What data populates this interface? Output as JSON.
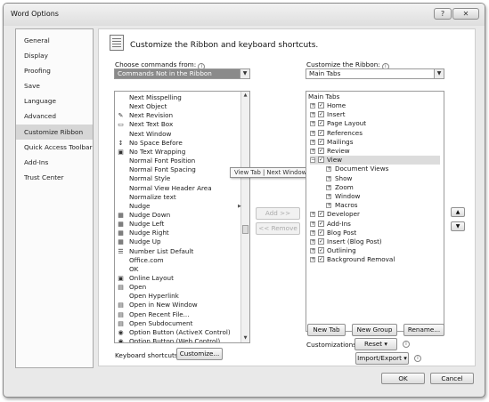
{
  "window": {
    "title": "Word Options",
    "help_label": "?",
    "close_label": "✕"
  },
  "sidebar": {
    "items": [
      {
        "label": "General"
      },
      {
        "label": "Display"
      },
      {
        "label": "Proofing"
      },
      {
        "label": "Save"
      },
      {
        "label": "Language"
      },
      {
        "label": "Advanced"
      },
      {
        "label": "Customize Ribbon",
        "active": true
      },
      {
        "label": "Quick Access Toolbar"
      },
      {
        "label": "Add-Ins"
      },
      {
        "label": "Trust Center"
      }
    ]
  },
  "main": {
    "title": "Customize the Ribbon and keyboard shortcuts.",
    "choose_label": "Choose commands from:",
    "choose_value": "Commands Not in the Ribbon",
    "customize_label": "Customize the Ribbon:",
    "customize_value": "Main Tabs",
    "info_icon": "i",
    "commands": [
      {
        "label": "Next Misspelling",
        "icon": ""
      },
      {
        "label": "Next Object",
        "icon": ""
      },
      {
        "label": "Next Revision",
        "icon": "✎"
      },
      {
        "label": "Next Text Box",
        "icon": "▭"
      },
      {
        "label": "Next Window",
        "icon": ""
      },
      {
        "label": "No Space Before",
        "icon": "↕"
      },
      {
        "label": "No Text Wrapping",
        "icon": "▣"
      },
      {
        "label": "Normal Font Position",
        "icon": ""
      },
      {
        "label": "Normal Font Spacing",
        "icon": ""
      },
      {
        "label": "Normal Style",
        "icon": ""
      },
      {
        "label": "Normal View Header Area",
        "icon": ""
      },
      {
        "label": "Normalize text",
        "icon": ""
      },
      {
        "label": "Nudge",
        "icon": "",
        "submenu": "▶"
      },
      {
        "label": "Nudge Down",
        "icon": "▦"
      },
      {
        "label": "Nudge Left",
        "icon": "▦"
      },
      {
        "label": "Nudge Right",
        "icon": "▦"
      },
      {
        "label": "Nudge Up",
        "icon": "▦"
      },
      {
        "label": "Number List Default",
        "icon": "☰"
      },
      {
        "label": "Office.com",
        "icon": ""
      },
      {
        "label": "OK",
        "icon": ""
      },
      {
        "label": "Online Layout",
        "icon": "▣"
      },
      {
        "label": "Open",
        "icon": "▤"
      },
      {
        "label": "Open Hyperlink",
        "icon": ""
      },
      {
        "label": "Open in New Window",
        "icon": "▤"
      },
      {
        "label": "Open Recent File...",
        "icon": "▤"
      },
      {
        "label": "Open Subdocument",
        "icon": "▤"
      },
      {
        "label": "Option Button (ActiveX Control)",
        "icon": "◉"
      },
      {
        "label": "Option Button (Web Control)",
        "icon": "◉"
      }
    ],
    "tooltip": "View Tab | Next Window | Next Window (WindowNext)",
    "add_button": "Add >>",
    "remove_button": "<< Remove",
    "tree_header": "Main Tabs",
    "tree": [
      {
        "label": "Home",
        "level": 0,
        "expander": "+",
        "checked": "✓"
      },
      {
        "label": "Insert",
        "level": 0,
        "expander": "+",
        "checked": "✓"
      },
      {
        "label": "Page Layout",
        "level": 0,
        "expander": "+",
        "checked": "✓"
      },
      {
        "label": "References",
        "level": 0,
        "expander": "+",
        "checked": "✓"
      },
      {
        "label": "Mailings",
        "level": 0,
        "expander": "+",
        "checked": "✓"
      },
      {
        "label": "Review",
        "level": 0,
        "expander": "+",
        "checked": "✓"
      },
      {
        "label": "View",
        "level": 0,
        "expander": "−",
        "checked": "✓",
        "selected": true
      },
      {
        "label": "Document Views",
        "level": 1,
        "expander": "+"
      },
      {
        "label": "Show",
        "level": 1,
        "expander": "+"
      },
      {
        "label": "Zoom",
        "level": 1,
        "expander": "+"
      },
      {
        "label": "Window",
        "level": 1,
        "expander": "+"
      },
      {
        "label": "Macros",
        "level": 1,
        "expander": "+"
      },
      {
        "label": "Developer",
        "level": 0,
        "expander": "+",
        "checked": "✓"
      },
      {
        "label": "Add-Ins",
        "level": 0,
        "expander": "+",
        "checked": "✓"
      },
      {
        "label": "Blog Post",
        "level": 0,
        "expander": "+",
        "checked": "✓"
      },
      {
        "label": "Insert (Blog Post)",
        "level": 0,
        "expander": "+",
        "checked": "✓"
      },
      {
        "label": "Outlining",
        "level": 0,
        "expander": "+",
        "checked": "✓"
      },
      {
        "label": "Background Removal",
        "level": 0,
        "expander": "+",
        "checked": "✓"
      }
    ],
    "move_up": "▲",
    "move_down": "▼",
    "new_tab": "New Tab",
    "new_group": "New Group",
    "rename": "Rename...",
    "customizations_label": "Customizations:",
    "reset_button": "Reset ▾",
    "import_export_button": "Import/Export ▾",
    "keyboard_label": "Keyboard shortcuts:",
    "customize_button": "Customize..."
  },
  "footer": {
    "ok": "OK",
    "cancel": "Cancel"
  }
}
